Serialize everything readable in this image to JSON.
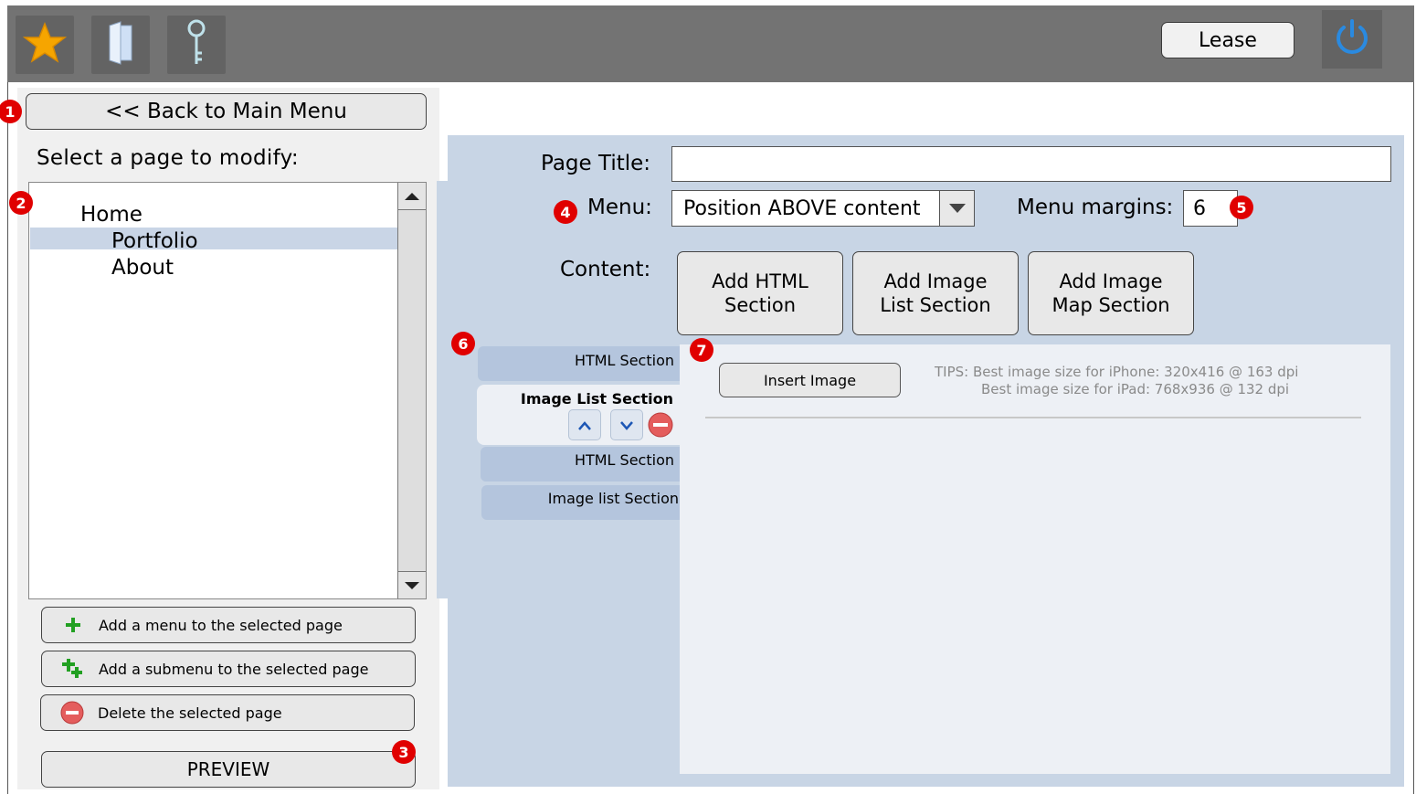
{
  "toolbar": {
    "icons": [
      "star-icon",
      "book-icon",
      "key-icon"
    ],
    "lease_label": "Lease",
    "power_icon": "power-icon"
  },
  "sidebar": {
    "back_label": "<< Back to Main Menu",
    "select_label": "Select a page to modify:",
    "pages": [
      {
        "label": "Home",
        "level": 0,
        "selected": false
      },
      {
        "label": "Portfolio",
        "level": 1,
        "selected": true
      },
      {
        "label": "About",
        "level": 1,
        "selected": false
      }
    ],
    "actions": [
      {
        "label": "Add a menu to the selected page",
        "icon": "plus-icon"
      },
      {
        "label": "Add a submenu to the selected page",
        "icon": "add-submenu-icon"
      },
      {
        "label": "Delete the selected page",
        "icon": "delete-icon"
      }
    ],
    "preview_label": "PREVIEW"
  },
  "editor": {
    "page_title_label": "Page Title:",
    "page_title_value": "",
    "menu_label": "Menu:",
    "menu_value": "Position ABOVE content",
    "menu_margins_label": "Menu margins:",
    "menu_margins_value": "6",
    "content_label": "Content:",
    "add_html_label": "Add HTML Section",
    "add_image_list_label": "Add Image List Section",
    "add_image_map_label": "Add Image Map Section",
    "sections": [
      {
        "label": "HTML Section",
        "active": false
      },
      {
        "label": "Image List Section",
        "active": true
      },
      {
        "label": "HTML Section",
        "active": false
      },
      {
        "label": "Image list Section",
        "active": false
      }
    ],
    "insert_image_label": "Insert Image",
    "tips_line1": "TIPS: Best image size for iPhone: 320x416 @ 163 dpi",
    "tips_line2": "Best image size for iPad: 768x936 @ 132 dpi"
  },
  "markers": [
    "1",
    "2",
    "3",
    "4",
    "5",
    "6",
    "7"
  ],
  "colors": {
    "toolbar": "#737373",
    "panel": "#c8d5e5",
    "selection": "#c9d5e6",
    "marker": "#e00000",
    "power": "#2a8ae0"
  }
}
